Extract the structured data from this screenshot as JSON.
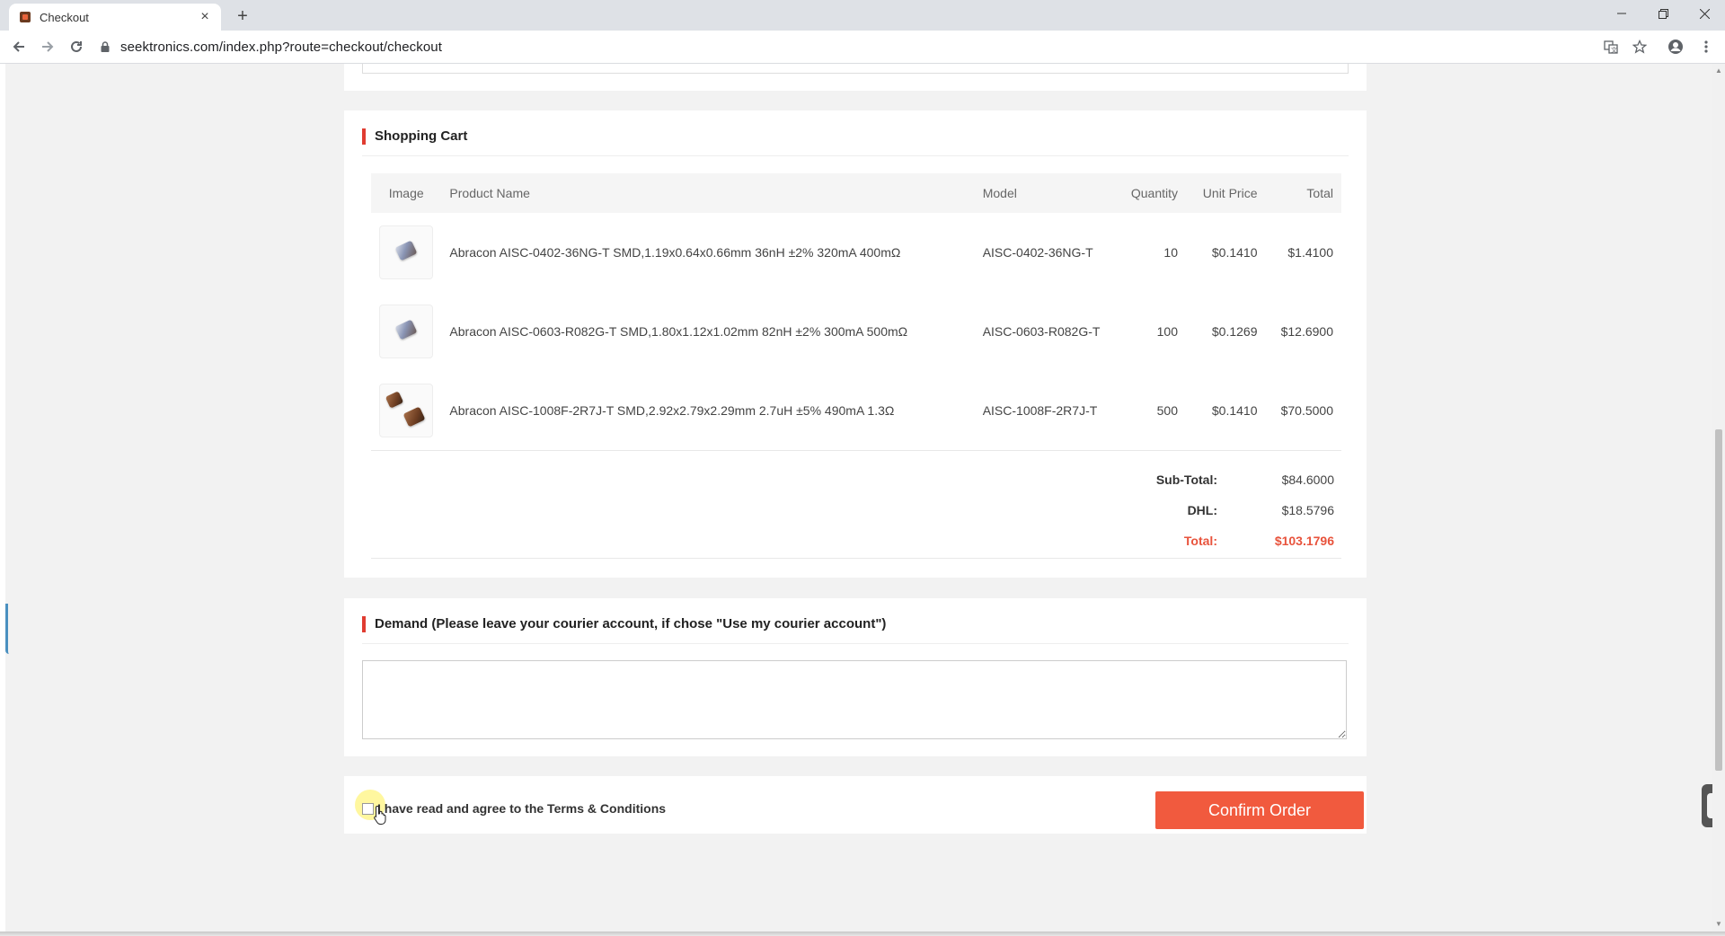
{
  "browser": {
    "tab_title": "Checkout",
    "new_tab_symbol": "+",
    "close_symbol": "×",
    "url": "seektronics.com/index.php?route=checkout/checkout",
    "icons": [
      "back-arrow-icon",
      "forward-arrow-icon",
      "reload-icon",
      "lock-icon",
      "translate-icon",
      "star-icon",
      "account-icon",
      "menu-dots-icon",
      "minimize-icon",
      "restore-icon",
      "close-window-icon"
    ]
  },
  "cart": {
    "title": "Shopping Cart",
    "headers": {
      "image": "Image",
      "product_name": "Product Name",
      "model": "Model",
      "quantity": "Quantity",
      "unit_price": "Unit Price",
      "total": "Total"
    },
    "rows": [
      {
        "name": "Abracon AISC-0402-36NG-T SMD,1.19x0.64x0.66mm 36nH ±2% 320mA 400mΩ",
        "model": "AISC-0402-36NG-T",
        "quantity": "10",
        "unit_price": "$0.1410",
        "total": "$1.4100",
        "thumb": "silver-chip"
      },
      {
        "name": "Abracon AISC-0603-R082G-T SMD,1.80x1.12x1.02mm 82nH ±2% 300mA 500mΩ",
        "model": "AISC-0603-R082G-T",
        "quantity": "100",
        "unit_price": "$0.1269",
        "total": "$12.6900",
        "thumb": "silver-chip"
      },
      {
        "name": "Abracon AISC-1008F-2R7J-T SMD,2.92x2.79x2.29mm 2.7uH ±5% 490mA 1.3Ω",
        "model": "AISC-1008F-2R7J-T",
        "quantity": "500",
        "unit_price": "$0.1410",
        "total": "$70.5000",
        "thumb": "brown-chips"
      }
    ],
    "totals": {
      "subtotal_label": "Sub-Total:",
      "subtotal_value": "$84.6000",
      "shipping_label": "DHL:",
      "shipping_value": "$18.5796",
      "total_label": "Total:",
      "total_value": "$103.1796"
    }
  },
  "demand": {
    "title": "Demand (Please leave your courier account, if chose \"Use my courier account\")",
    "textarea_value": ""
  },
  "terms": {
    "label": "I have read and agree to the Terms & Conditions",
    "checked": false
  },
  "confirm_button": "Confirm Order",
  "colors": {
    "accent_red": "#e03c31",
    "confirm_orange": "#f15a3e",
    "total_red": "#e8533c",
    "page_bg": "#f2f2f2"
  }
}
